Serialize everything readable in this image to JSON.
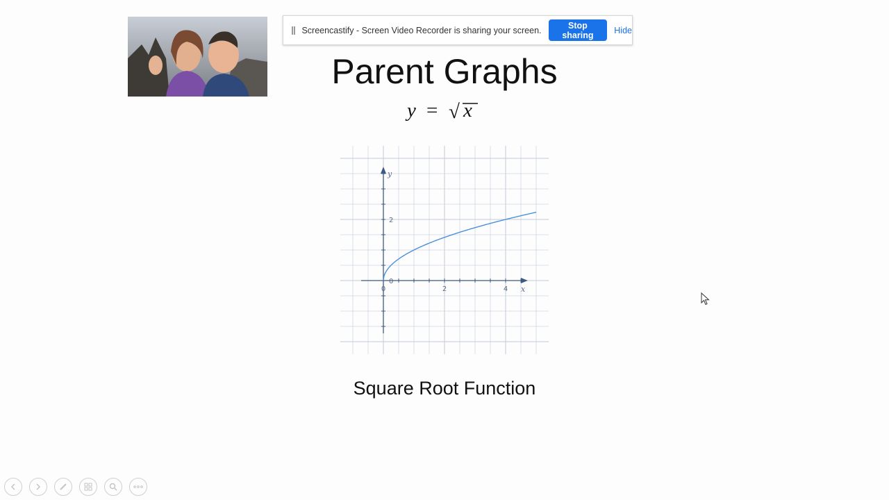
{
  "share_bar": {
    "message": "Screencastify - Screen Video Recorder is sharing your screen.",
    "stop_label": "Stop sharing",
    "hide_label": "Hide"
  },
  "slide": {
    "title": "Parent Graphs",
    "equation": {
      "lhs": "y",
      "equals": "=",
      "radical": "√",
      "radicand": "x"
    },
    "subtitle": "Square Root Function"
  },
  "chart_data": {
    "type": "line",
    "function": "sqrt(x)",
    "series": [
      {
        "x": [
          0,
          0.05,
          0.25,
          0.5,
          1,
          1.5,
          2,
          2.5,
          3,
          3.5,
          4,
          4.5,
          5
        ],
        "y": [
          0,
          0.224,
          0.5,
          0.707,
          1,
          1.225,
          1.414,
          1.581,
          1.732,
          1.871,
          2,
          2.121,
          2.236
        ]
      }
    ],
    "xlabel": "x",
    "ylabel": "y",
    "x_ticks": [
      "0",
      "2",
      "4"
    ],
    "y_ticks": [
      "0",
      "2"
    ],
    "xlim": [
      -1.5,
      5.5
    ],
    "ylim": [
      -2,
      4
    ],
    "grid": true,
    "color": "#4a90d9"
  },
  "controls": {
    "icons": [
      "previous-icon",
      "next-icon",
      "pen-icon",
      "slides-icon",
      "zoom-icon",
      "more-icon"
    ]
  },
  "colors": {
    "stop_button": "#1a73e8",
    "hide_link": "#1a73e8",
    "axis": "#3d5a80",
    "grid": "#d9dee6"
  }
}
